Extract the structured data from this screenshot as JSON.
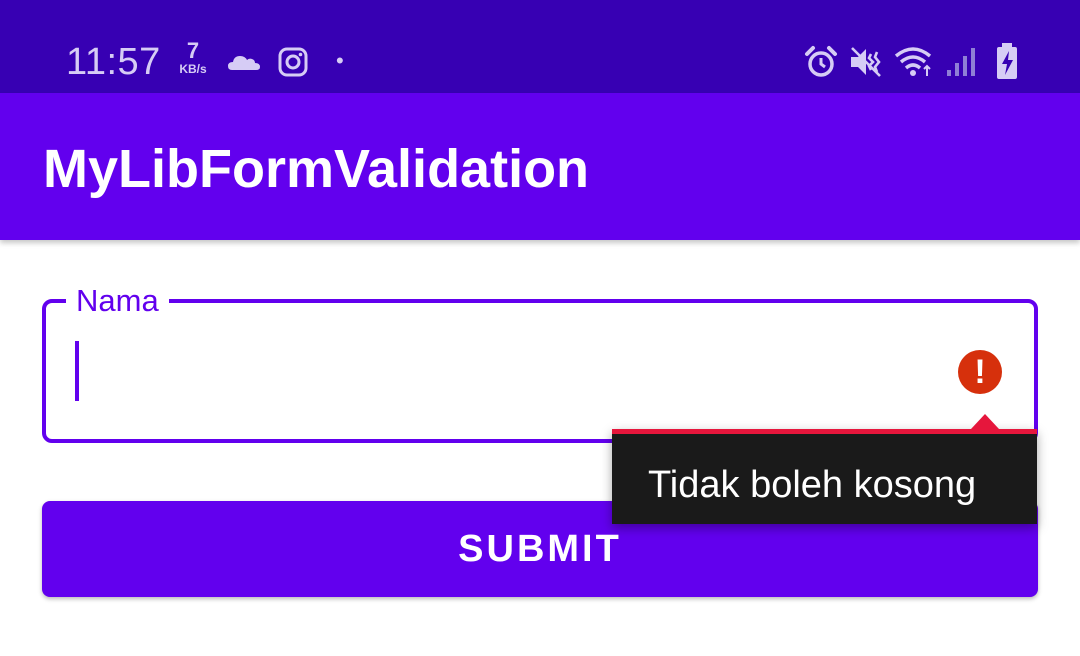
{
  "status_bar": {
    "time": "11:57",
    "net_speed_value": "7",
    "net_speed_unit": "KB/s",
    "notification_dot": "•",
    "icons": [
      "cloud-icon",
      "instagram-icon",
      "alarm-icon",
      "vibrate-icon",
      "wifi-icon",
      "signal-icon",
      "battery-charging-icon"
    ]
  },
  "app_bar": {
    "title": "MyLibFormValidation"
  },
  "form": {
    "name_field": {
      "label": "Nama",
      "value": "",
      "error_icon": "error-icon",
      "error_icon_glyph": "!",
      "error_message": "Tidak boleh kosong"
    },
    "submit_label": "SUBMIT"
  },
  "colors": {
    "status_bar": "#3700b3",
    "primary": "#6200ee",
    "error": "#d6300c",
    "error_underline": "#e6163c",
    "error_popup_bg": "#1a1a1a"
  }
}
